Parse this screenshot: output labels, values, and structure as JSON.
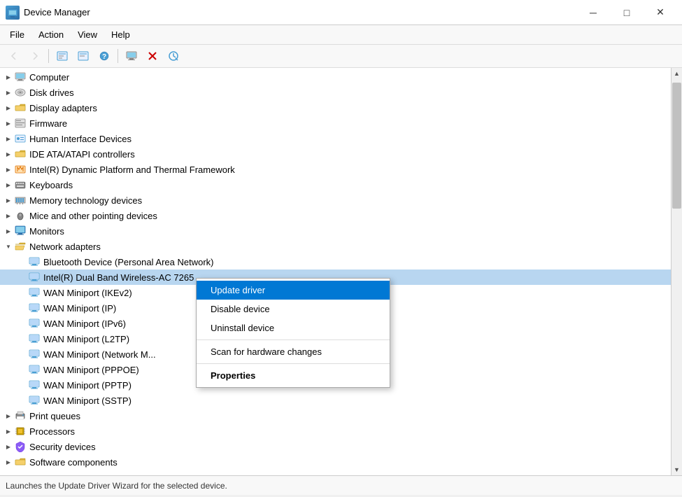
{
  "titleBar": {
    "title": "Device Manager",
    "icon": "DM",
    "minimize": "─",
    "maximize": "□",
    "close": "✕"
  },
  "menuBar": {
    "items": [
      "File",
      "Action",
      "View",
      "Help"
    ]
  },
  "toolbar": {
    "buttons": [
      {
        "name": "back",
        "icon": "◀",
        "enabled": false
      },
      {
        "name": "forward",
        "icon": "▶",
        "enabled": false
      },
      {
        "name": "properties",
        "icon": "⊞",
        "enabled": true
      },
      {
        "name": "update-driver",
        "icon": "⊟",
        "enabled": true
      },
      {
        "name": "help",
        "icon": "?",
        "enabled": true
      },
      {
        "sep": true
      },
      {
        "name": "computer",
        "icon": "🖥",
        "enabled": true
      },
      {
        "name": "scan",
        "icon": "❌",
        "enabled": true
      },
      {
        "name": "download",
        "icon": "⊕",
        "enabled": true
      }
    ]
  },
  "tree": {
    "items": [
      {
        "id": "computer",
        "label": "Computer",
        "level": 1,
        "expanded": false,
        "icon": "computer",
        "hasExpand": true
      },
      {
        "id": "disk-drives",
        "label": "Disk drives",
        "level": 1,
        "expanded": false,
        "icon": "disk",
        "hasExpand": true
      },
      {
        "id": "display-adapters",
        "label": "Display adapters",
        "level": 1,
        "expanded": false,
        "icon": "folder",
        "hasExpand": true
      },
      {
        "id": "firmware",
        "label": "Firmware",
        "level": 1,
        "expanded": false,
        "icon": "firmware",
        "hasExpand": true
      },
      {
        "id": "human-interface",
        "label": "Human Interface Devices",
        "level": 1,
        "expanded": false,
        "icon": "hid",
        "hasExpand": true
      },
      {
        "id": "ide-controllers",
        "label": "IDE ATA/ATAPI controllers",
        "level": 1,
        "expanded": false,
        "icon": "folder",
        "hasExpand": true
      },
      {
        "id": "intel-thermal",
        "label": "Intel(R) Dynamic Platform and Thermal Framework",
        "level": 1,
        "expanded": false,
        "icon": "thermal",
        "hasExpand": true
      },
      {
        "id": "keyboards",
        "label": "Keyboards",
        "level": 1,
        "expanded": false,
        "icon": "keyboard",
        "hasExpand": true
      },
      {
        "id": "memory",
        "label": "Memory technology devices",
        "level": 1,
        "expanded": false,
        "icon": "memory",
        "hasExpand": true
      },
      {
        "id": "mice",
        "label": "Mice and other pointing devices",
        "level": 1,
        "expanded": false,
        "icon": "mouse",
        "hasExpand": true
      },
      {
        "id": "monitors",
        "label": "Monitors",
        "level": 1,
        "expanded": false,
        "icon": "monitor",
        "hasExpand": true
      },
      {
        "id": "network-adapters",
        "label": "Network adapters",
        "level": 1,
        "expanded": true,
        "icon": "folder-open",
        "hasExpand": true
      },
      {
        "id": "bluetooth",
        "label": "Bluetooth Device (Personal Area Network)",
        "level": 2,
        "expanded": false,
        "icon": "network",
        "hasExpand": false
      },
      {
        "id": "intel-wifi",
        "label": "Intel(R) Dual Band Wireless-AC 7265",
        "level": 2,
        "expanded": false,
        "icon": "network",
        "hasExpand": false,
        "contextSelected": true
      },
      {
        "id": "wan-ikev2",
        "label": "WAN Miniport (IKEv2)",
        "level": 2,
        "expanded": false,
        "icon": "network",
        "hasExpand": false
      },
      {
        "id": "wan-ip",
        "label": "WAN Miniport (IP)",
        "level": 2,
        "expanded": false,
        "icon": "network",
        "hasExpand": false
      },
      {
        "id": "wan-ipv6",
        "label": "WAN Miniport (IPv6)",
        "level": 2,
        "expanded": false,
        "icon": "network",
        "hasExpand": false
      },
      {
        "id": "wan-l2tp",
        "label": "WAN Miniport (L2TP)",
        "level": 2,
        "expanded": false,
        "icon": "network",
        "hasExpand": false
      },
      {
        "id": "wan-network",
        "label": "WAN Miniport (Network M...",
        "level": 2,
        "expanded": false,
        "icon": "network",
        "hasExpand": false
      },
      {
        "id": "wan-pppoe",
        "label": "WAN Miniport (PPPOE)",
        "level": 2,
        "expanded": false,
        "icon": "network",
        "hasExpand": false
      },
      {
        "id": "wan-pptp",
        "label": "WAN Miniport (PPTP)",
        "level": 2,
        "expanded": false,
        "icon": "network",
        "hasExpand": false
      },
      {
        "id": "wan-sstp",
        "label": "WAN Miniport (SSTP)",
        "level": 2,
        "expanded": false,
        "icon": "network",
        "hasExpand": false
      },
      {
        "id": "print-queues",
        "label": "Print queues",
        "level": 1,
        "expanded": false,
        "icon": "printer",
        "hasExpand": true
      },
      {
        "id": "processors",
        "label": "Processors",
        "level": 1,
        "expanded": false,
        "icon": "processor",
        "hasExpand": true
      },
      {
        "id": "security-devices",
        "label": "Security devices",
        "level": 1,
        "expanded": false,
        "icon": "security",
        "hasExpand": true
      },
      {
        "id": "software-components",
        "label": "Software components",
        "level": 1,
        "expanded": false,
        "icon": "folder",
        "hasExpand": true
      }
    ]
  },
  "contextMenu": {
    "items": [
      {
        "id": "update-driver",
        "label": "Update driver",
        "active": true
      },
      {
        "id": "disable-device",
        "label": "Disable device",
        "active": false
      },
      {
        "id": "uninstall-device",
        "label": "Uninstall device",
        "active": false
      },
      {
        "id": "sep1",
        "separator": true
      },
      {
        "id": "scan-changes",
        "label": "Scan for hardware changes",
        "active": false
      },
      {
        "id": "sep2",
        "separator": true
      },
      {
        "id": "properties",
        "label": "Properties",
        "active": false,
        "bold": true
      }
    ]
  },
  "statusBar": {
    "text": "Launches the Update Driver Wizard for the selected device."
  },
  "icons": {
    "folder": "📁",
    "folder-open": "📂",
    "computer": "🖥",
    "disk": "💽",
    "hid": "⌨",
    "keyboard": "⌨",
    "mouse": "🖱",
    "monitor": "🖥",
    "memory": "🔌",
    "network": "🌐",
    "thermal": "🔧",
    "firmware": "📋",
    "printer": "🖨",
    "processor": "⚙",
    "security": "🔒"
  }
}
